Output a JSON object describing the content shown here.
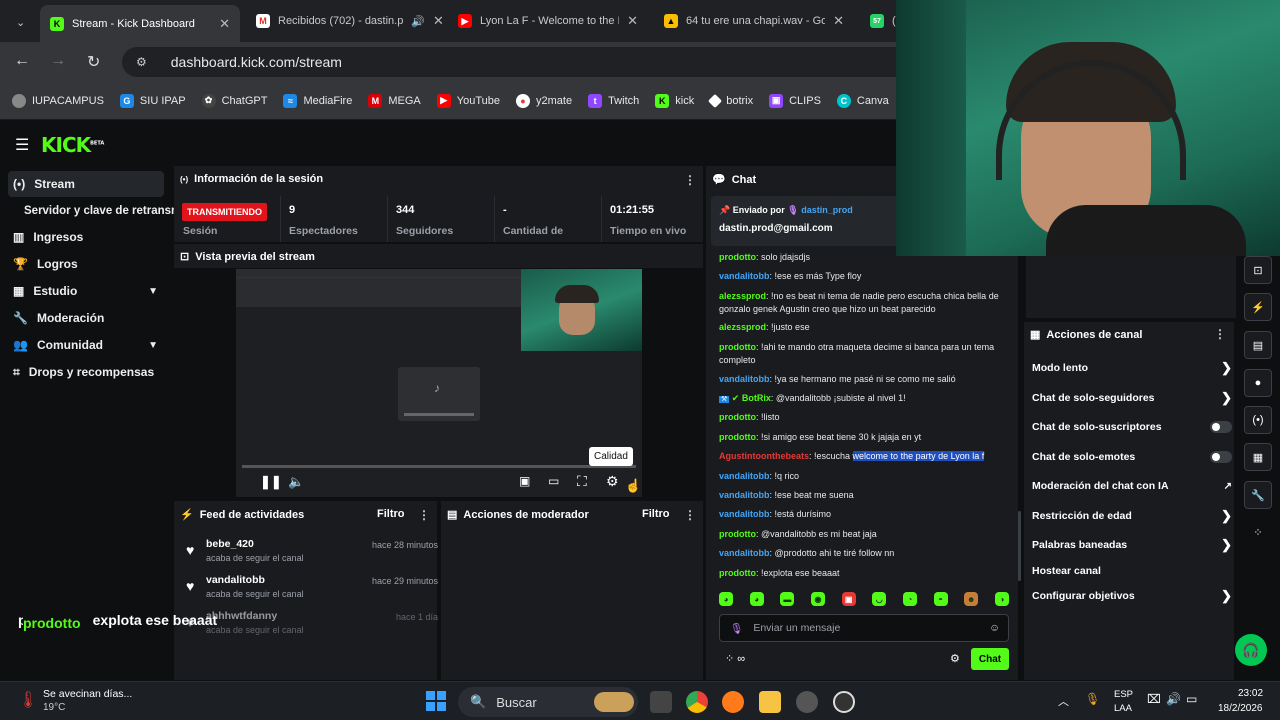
{
  "browser": {
    "tabs": [
      {
        "title": "Stream - Kick Dashboard",
        "icon": "kick-icon",
        "active": true
      },
      {
        "title": "Recibidos (702) - dastin.p",
        "icon": "gmail-icon"
      },
      {
        "title": "Lyon La F - Welcome to the P",
        "icon": "youtube-icon"
      },
      {
        "title": "64 tu ere una chapi.wav - Goo",
        "icon": "drive-icon"
      },
      {
        "title": "(5",
        "icon": "whatsapp-icon",
        "badge": "57"
      }
    ],
    "url": "dashboard.kick.com/stream",
    "bookmarks": [
      "IUPACAMPUS",
      "SIU IPAP",
      "ChatGPT",
      "MediaFire",
      "MEGA",
      "YouTube",
      "y2mate",
      "Twitch",
      "kick",
      "botrix",
      "CLIPS",
      "Canva"
    ]
  },
  "kick": {
    "logo": "KICK",
    "logo_sup": "BETA",
    "sidebar": [
      {
        "label": "Stream",
        "icon": "broadcast-icon",
        "active": true
      },
      {
        "label": "Servidor y clave de retransm",
        "icon": ""
      },
      {
        "label": "Ingresos",
        "icon": "bank-icon"
      },
      {
        "label": "Logros",
        "icon": "trophy-icon"
      },
      {
        "label": "Estudio",
        "icon": "grid-icon",
        "expand": true
      },
      {
        "label": "Moderación",
        "icon": "wrench-icon"
      },
      {
        "label": "Comunidad",
        "icon": "people-icon",
        "expand": true
      },
      {
        "label": "Drops y recompensas",
        "icon": "drops-icon"
      }
    ],
    "session": {
      "title": "Información de la sesión",
      "live_badge": "TRANSMITIENDO",
      "session_label": "Sesión",
      "stats": [
        {
          "value": "9",
          "label": "Espectadores"
        },
        {
          "value": "344",
          "label": "Seguidores"
        },
        {
          "value": "-",
          "label": "Cantidad de"
        },
        {
          "value": "01:21:55",
          "label": "Tiempo en vivo"
        }
      ]
    },
    "preview": {
      "title": "Vista previa del stream",
      "tooltip": "Calidad"
    },
    "feed": {
      "title": "Feed de actividades",
      "filter": "Filtro",
      "items": [
        {
          "name": "bebe_420",
          "sub": "acaba de seguir el canal",
          "time": "hace 28 minutos"
        },
        {
          "name": "vandalitobb",
          "sub": "acaba de seguir el canal",
          "time": "hace 29 minutos"
        },
        {
          "name": "ahhhwtfdanny",
          "sub": "acaba de seguir el canal",
          "time": "hace 1 día"
        }
      ]
    },
    "modactions": {
      "title": "Acciones de moderador",
      "filter": "Filtro"
    },
    "chat": {
      "title": "Chat",
      "pinned_by_label": "Enviado por",
      "pinned_by_user": "dastin_prod",
      "pinned_text": "dastin.prod@gmail.com",
      "messages": [
        {
          "user": "prodotto",
          "color": "g",
          "text": "solo jdajsdjs"
        },
        {
          "user": "vandalitobb",
          "color": "b",
          "text": "!ese es más Type floy"
        },
        {
          "user": "alezssprod",
          "color": "g",
          "text": "!no es beat ni tema de nadie pero escucha chica bella de gonzalo genek Agustin creo que hizo un beat parecido"
        },
        {
          "user": "alezssprod",
          "color": "g",
          "text": "!justo ese"
        },
        {
          "user": "prodotto",
          "color": "g",
          "text": "!ahi te mando otra maqueta decime si banca para un tema completo"
        },
        {
          "user": "vandalitobb",
          "color": "b",
          "text": "!ya se hermano me pasé ni se como me salió"
        },
        {
          "user": "BotRix",
          "color": "g",
          "text": "@vandalitobb ¡subiste al nivel 1!"
        },
        {
          "user": "prodotto",
          "color": "g",
          "text": "!listo"
        },
        {
          "user": "prodotto",
          "color": "g",
          "text": "!si amigo ese beat tiene 30 k jajaja en yt"
        },
        {
          "user": "Agustintoonthebeats",
          "color": "r",
          "text": "!escucha ",
          "highlight": "welcome to the party de Lyon la f"
        },
        {
          "user": "vandalitobb",
          "color": "b",
          "text": "!q rico"
        },
        {
          "user": "vandalitobb",
          "color": "b",
          "text": "!ese beat me suena"
        },
        {
          "user": "vandalitobb",
          "color": "b",
          "text": "!está durísimo"
        },
        {
          "user": "prodotto",
          "color": "g",
          "text": "@vandalitobb es mi beat jaja"
        },
        {
          "user": "vandalitobb",
          "color": "b",
          "text": "@prodotto ahi te tiré follow nn"
        },
        {
          "user": "prodotto",
          "color": "g",
          "text": "!explota ese beaaat"
        }
      ],
      "placeholder": "Enviar un mensaje",
      "send": "Chat"
    },
    "channel_actions": {
      "title": "Acciones de canal",
      "items": [
        {
          "label": "Modo lento",
          "control": "arrow"
        },
        {
          "label": "Chat de solo-seguidores",
          "control": "arrow"
        },
        {
          "label": "Chat de solo-suscriptores",
          "control": "toggle"
        },
        {
          "label": "Chat de solo-emotes",
          "control": "toggle"
        },
        {
          "label": "Moderación del chat con IA",
          "control": "external"
        },
        {
          "label": "Restricción de edad",
          "control": "arrow"
        },
        {
          "label": "Palabras baneadas",
          "control": "arrow"
        },
        {
          "label": "Hostear canal",
          "control": "none"
        },
        {
          "label": "Configurar objetivos",
          "control": "arrow"
        }
      ]
    },
    "overlay_caption": "prodotto : !explota ese beaaat"
  },
  "taskbar": {
    "weather_text": "Se avecinan días...",
    "weather_temp": "19°C",
    "search": "Buscar",
    "lang": "ESP",
    "lang2": "LAA",
    "time": "23:02",
    "date": "18/2/2026"
  },
  "colors": {
    "kick_green": "#53fc18",
    "live_red": "#e1141b",
    "panel": "#191b1f",
    "bg": "#0e0f11"
  }
}
